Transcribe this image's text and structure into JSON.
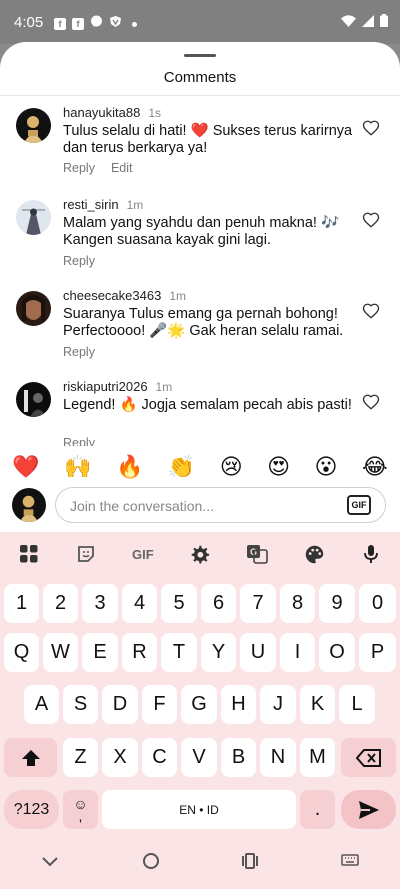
{
  "status_bar": {
    "time": "4:05",
    "icons": [
      "facebook-icon",
      "facebook-icon",
      "messenger-icon",
      "vpn-shield-icon",
      "dot-icon"
    ],
    "right_icons": [
      "wifi-icon",
      "signal-icon",
      "battery-icon"
    ]
  },
  "sheet": {
    "title": "Comments"
  },
  "comments": [
    {
      "username": "hanayukita88",
      "time": "1s",
      "text": "Tulus selalu di hati! ❤️ Sukses terus karirnya dan terus berkarya ya!",
      "actions": [
        "Reply",
        "Edit"
      ]
    },
    {
      "username": "resti_sirin",
      "time": "1m",
      "text": "Malam yang syahdu dan penuh makna! 🎶 Kangen suasana kayak gini lagi.",
      "actions": [
        "Reply"
      ]
    },
    {
      "username": "cheesecake3463",
      "time": "1m",
      "text": "Suaranya Tulus emang ga pernah bohong! Perfectoooo! 🎤🌟 Gak heran selalu ramai.",
      "actions": [
        "Reply"
      ]
    },
    {
      "username": "riskiaputri2026",
      "time": "1m",
      "text": "Legend! 🔥 Jogja semalam pecah abis pasti!",
      "actions": [
        "Reply"
      ]
    }
  ],
  "emoji_bar": [
    "❤️",
    "🙌",
    "🔥",
    "👏",
    "😢",
    "😍",
    "😮",
    "😂"
  ],
  "composer": {
    "placeholder": "Join the conversation...",
    "gif_label": "GIF"
  },
  "keyboard": {
    "toolbar": [
      "apps-grid-icon",
      "sticker-icon",
      "GIF",
      "settings-gear-icon",
      "translate-icon",
      "palette-icon",
      "microphone-icon"
    ],
    "toolbar_gif": "GIF",
    "row1": [
      "1",
      "2",
      "3",
      "4",
      "5",
      "6",
      "7",
      "8",
      "9",
      "0"
    ],
    "row2": [
      "Q",
      "W",
      "E",
      "R",
      "T",
      "Y",
      "U",
      "I",
      "O",
      "P"
    ],
    "row3": [
      "A",
      "S",
      "D",
      "F",
      "G",
      "H",
      "J",
      "K",
      "L"
    ],
    "row4": [
      "Z",
      "X",
      "C",
      "V",
      "B",
      "N",
      "M"
    ],
    "symbols_label": "?123",
    "emoji_comma": ",",
    "space_label": "EN • ID",
    "period": "."
  },
  "nav": [
    "back-chevron-icon",
    "home-circle-icon",
    "recents-icon",
    "keyboard-switch-icon"
  ]
}
